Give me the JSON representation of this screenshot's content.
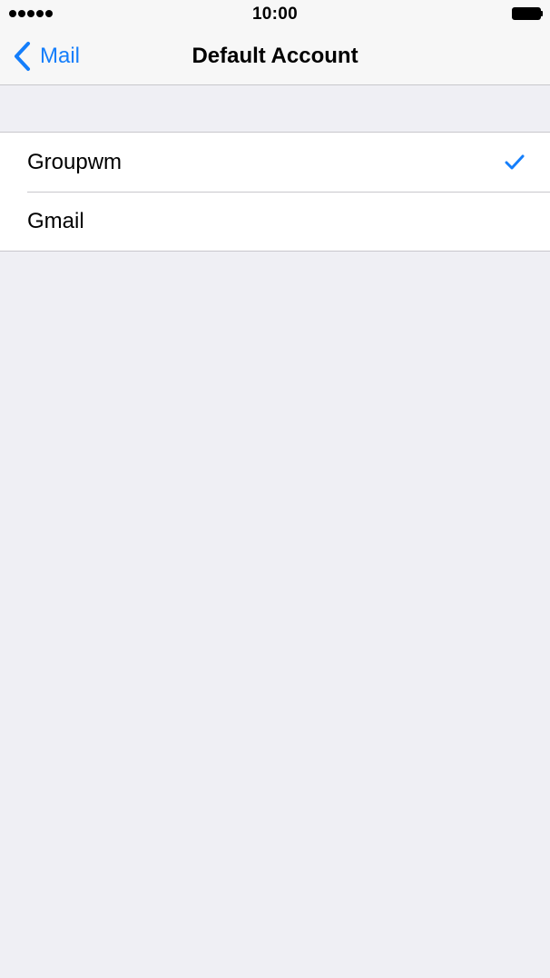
{
  "status_bar": {
    "time": "10:00"
  },
  "nav": {
    "back_label": "Mail",
    "title": "Default Account"
  },
  "accounts": [
    {
      "label": "Groupwm",
      "selected": true
    },
    {
      "label": "Gmail",
      "selected": false
    }
  ],
  "colors": {
    "accent": "#147efb",
    "background": "#efeff4",
    "separator": "#c8c7cc"
  },
  "icons": {
    "back": "chevron-left-icon",
    "selected": "checkmark-icon",
    "signal": "signal-strength-icon",
    "battery": "battery-icon"
  }
}
